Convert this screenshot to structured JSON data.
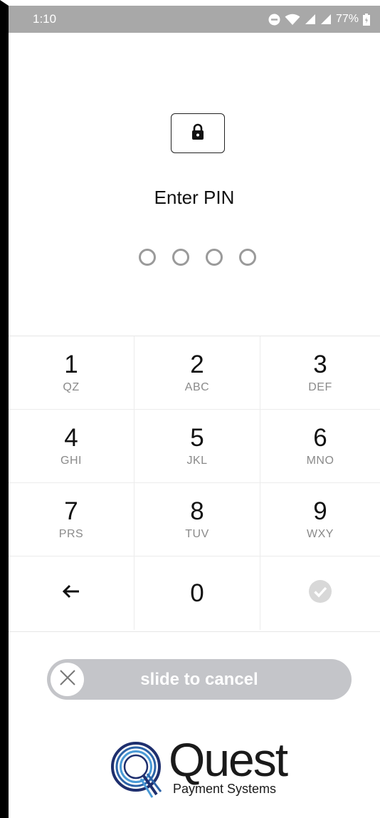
{
  "status_bar": {
    "time": "1:10",
    "battery": "77%"
  },
  "lock_icon": "lock-icon",
  "title": "Enter PIN",
  "pin_slots": 4,
  "keypad": {
    "keys": [
      {
        "digit": "1",
        "letters": "QZ"
      },
      {
        "digit": "2",
        "letters": "ABC"
      },
      {
        "digit": "3",
        "letters": "DEF"
      },
      {
        "digit": "4",
        "letters": "GHI"
      },
      {
        "digit": "5",
        "letters": "JKL"
      },
      {
        "digit": "6",
        "letters": "MNO"
      },
      {
        "digit": "7",
        "letters": "PRS"
      },
      {
        "digit": "8",
        "letters": "TUV"
      },
      {
        "digit": "9",
        "letters": "WXY"
      },
      {
        "digit": "0",
        "letters": ""
      }
    ],
    "back_icon": "arrow-left-icon",
    "confirm_icon": "check-circle-icon"
  },
  "slider": {
    "label": "slide to cancel",
    "knob_icon": "close-icon"
  },
  "brand": {
    "name": "Quest",
    "subtitle": "Payment Systems",
    "colors": {
      "ring_dark": "#1e2f6e",
      "ring_mid": "#2c63a8",
      "ring_light": "#4a9ad6"
    }
  },
  "colors": {
    "status_bar": "#a8a8a8",
    "slider_track": "#c4c5c9",
    "pin_dot": "#9a9a9a",
    "confirm_icon": "#d8d8d8"
  }
}
